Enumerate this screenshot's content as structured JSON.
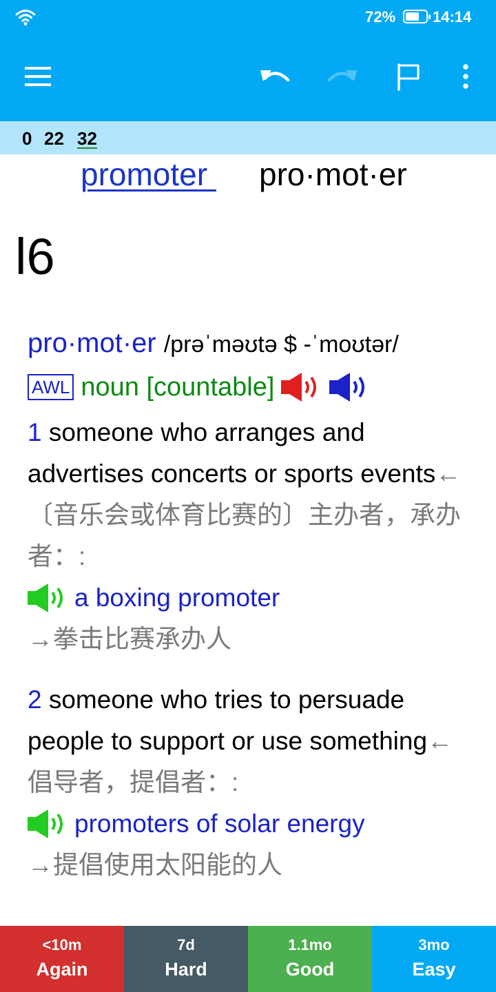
{
  "status_bar": {
    "battery_percent": "72%",
    "battery_level": 0.72,
    "time": "14:14",
    "icons": [
      "wifi-icon",
      "battery-icon"
    ]
  },
  "toolbar": {
    "icons": [
      "menu-icon",
      "undo-icon",
      "redo-icon",
      "flag-icon",
      "more-vert-icon"
    ]
  },
  "counts": {
    "new": "0",
    "learning": "22",
    "review": "32"
  },
  "card": {
    "front_word": "promoter ",
    "front_syllables": "pro·mot·er",
    "level": "l6",
    "headword": "pro·mot·er",
    "pronunciation": "/prəˈməʊtə $ -ˈmoʊtər/",
    "awl_badge": "AWL",
    "part_of_speech": "noun [countable]",
    "senses": [
      {
        "number": "1",
        "definition": "someone who arranges and advertises concerts or sports events",
        "translation": "←〔音乐会或体育比赛的〕主办者，承办者：:",
        "example": "a boxing promoter",
        "example_translation": "→拳击比赛承办人"
      },
      {
        "number": "2",
        "definition": "someone who tries to persuade people to support or use something",
        "translation": "←倡导者，提倡者：:",
        "example": "promoters of solar energy",
        "example_translation": "→提倡使用太阳能的人"
      }
    ]
  },
  "answers": [
    {
      "interval": "<10m",
      "label": "Again"
    },
    {
      "interval": "7d",
      "label": "Hard"
    },
    {
      "interval": "1.1mo",
      "label": "Good"
    },
    {
      "interval": "3mo",
      "label": "Easy"
    }
  ],
  "colors": {
    "toolbar": "#03a9f4",
    "counts_strip": "#b3e5fc",
    "again": "#d32f2f",
    "hard": "#455a64",
    "good": "#4caf50",
    "easy": "#03a9f4",
    "headword_blue": "#1a22c8",
    "pos_green": "#0a8a12",
    "speaker_uk_red": "#e02020",
    "speaker_us_blue": "#1a22c8",
    "speaker_example_green": "#22cc22"
  }
}
